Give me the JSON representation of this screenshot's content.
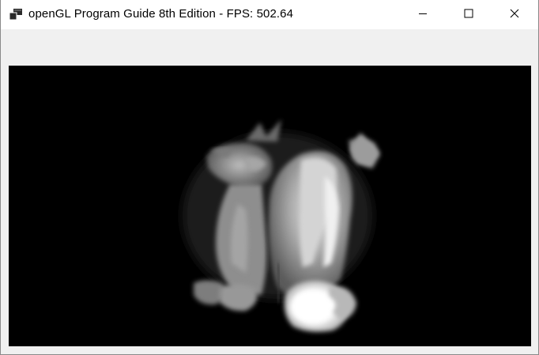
{
  "window": {
    "title": "openGL Program Guide 8th Edition - FPS: 502.64",
    "icons": {
      "app": "app-window-icon",
      "minimize": "minimize-icon",
      "maximize": "maximize-icon",
      "close": "close-icon"
    }
  },
  "viewport": {
    "background": "#000000",
    "content": "dragon-model-render"
  }
}
